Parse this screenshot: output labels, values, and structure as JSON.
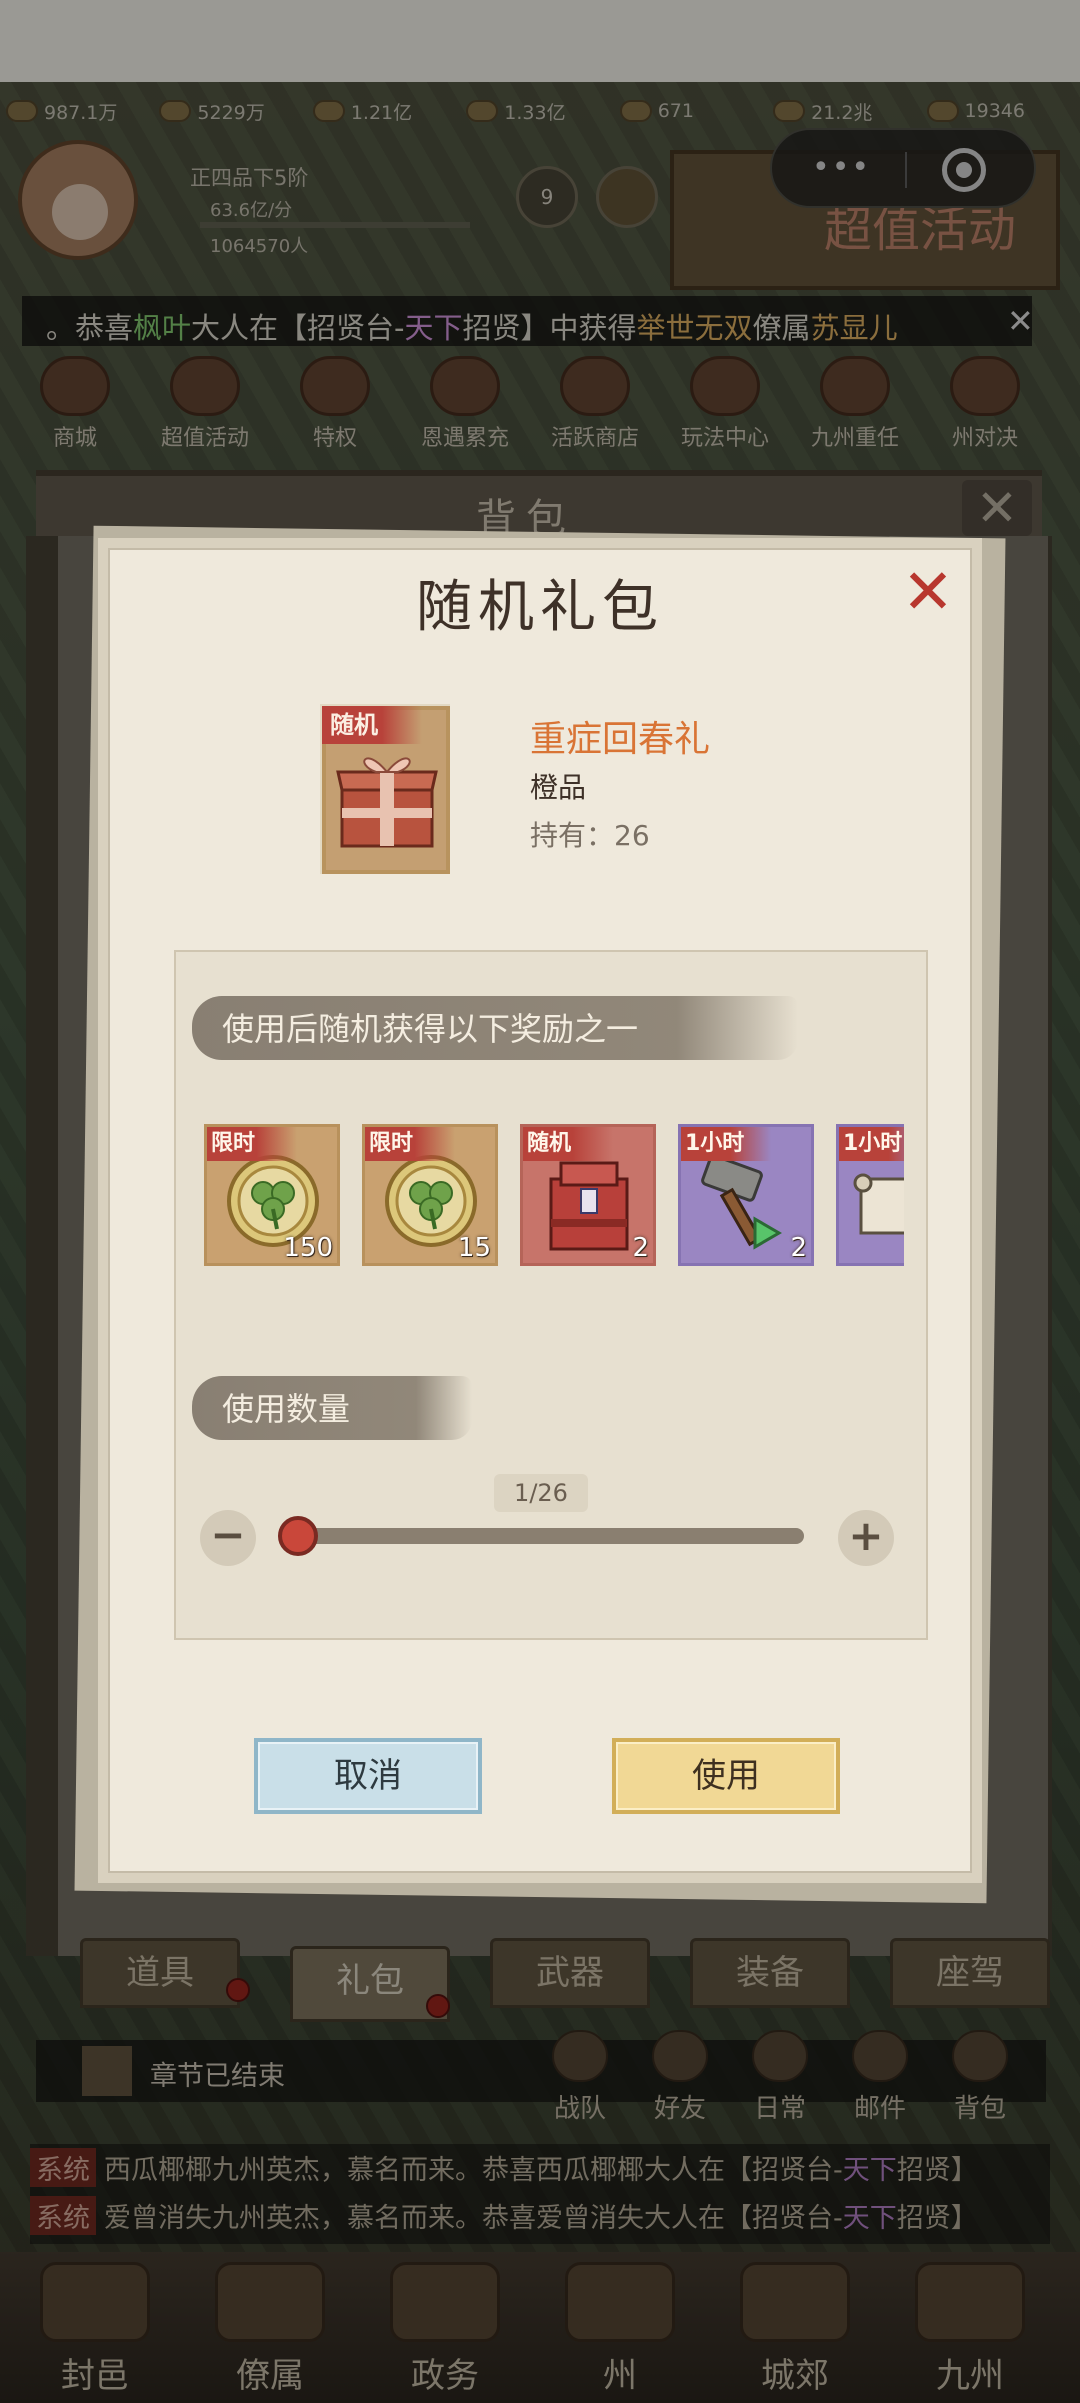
{
  "resources": [
    "987.1万",
    "5229万",
    "1.21亿",
    "1.33亿",
    "671",
    "21.2兆",
    "19346"
  ],
  "profile": {
    "rank": "正四品下5阶",
    "power": "63.6亿/分",
    "people": "1064570人"
  },
  "top_badge": "9",
  "promo_label": "超值活动",
  "ticker": {
    "prefix": "。恭喜",
    "name": "枫叶",
    "mid1": "大人在【招贤台-",
    "pool": "天下",
    "mid2": "招贤】中获得",
    "reward": "举世无双",
    "mid3": "僚属",
    "hero": "苏显儿"
  },
  "menu": [
    "商城",
    "超值活动",
    "特权",
    "恩遇累充",
    "活跃商店",
    "玩法中心",
    "九州重任",
    "州对决"
  ],
  "backpack": {
    "title": "背包",
    "tabs": [
      "道具",
      "礼包",
      "武器",
      "装备",
      "座驾"
    ]
  },
  "modal": {
    "title": "随机礼包",
    "item": {
      "badge": "随机",
      "name": "重症回春礼",
      "quality": "橙品",
      "owned_label": "持有：26"
    },
    "rewards_header": "使用后随机获得以下奖励之一",
    "rewards": [
      {
        "tag": "限时",
        "count": "150",
        "icon": "clover-coin-icon",
        "bg": "gold"
      },
      {
        "tag": "限时",
        "count": "15",
        "icon": "clover-coin-icon",
        "bg": "gold"
      },
      {
        "tag": "随机",
        "count": "2",
        "icon": "gift-box-icon",
        "bg": "red"
      },
      {
        "tag": "1小时",
        "count": "2",
        "icon": "hammer-speedup-icon",
        "bg": "purple"
      },
      {
        "tag": "1小时",
        "count": "",
        "icon": "scroll-icon",
        "bg": "purple"
      }
    ],
    "quantity_header": "使用数量",
    "quantity_value": "1/26",
    "cancel_label": "取消",
    "use_label": "使用"
  },
  "chapter_text": "章节已结束",
  "bottom_icons": [
    "战队",
    "好友",
    "日常",
    "邮件",
    "背包"
  ],
  "syslog": [
    {
      "tag": "系统",
      "text": "西瓜椰椰九州英杰，慕名而来。恭喜西瓜椰椰大人在【招贤台-",
      "pool": "天下",
      "end": "招贤】"
    },
    {
      "tag": "系统",
      "text": "爱曾消失九州英杰，慕名而来。恭喜爱曾消失大人在【招贤台-",
      "pool": "天下",
      "end": "招贤】"
    }
  ],
  "bottom_nav": [
    "封邑",
    "僚属",
    "政务",
    "州",
    "城郊",
    "九州"
  ],
  "colors": {
    "accent_red": "#b8372e",
    "orange_item": "#d97435",
    "cancel_blue": "#c9dfe8",
    "use_gold": "#f1d895"
  }
}
